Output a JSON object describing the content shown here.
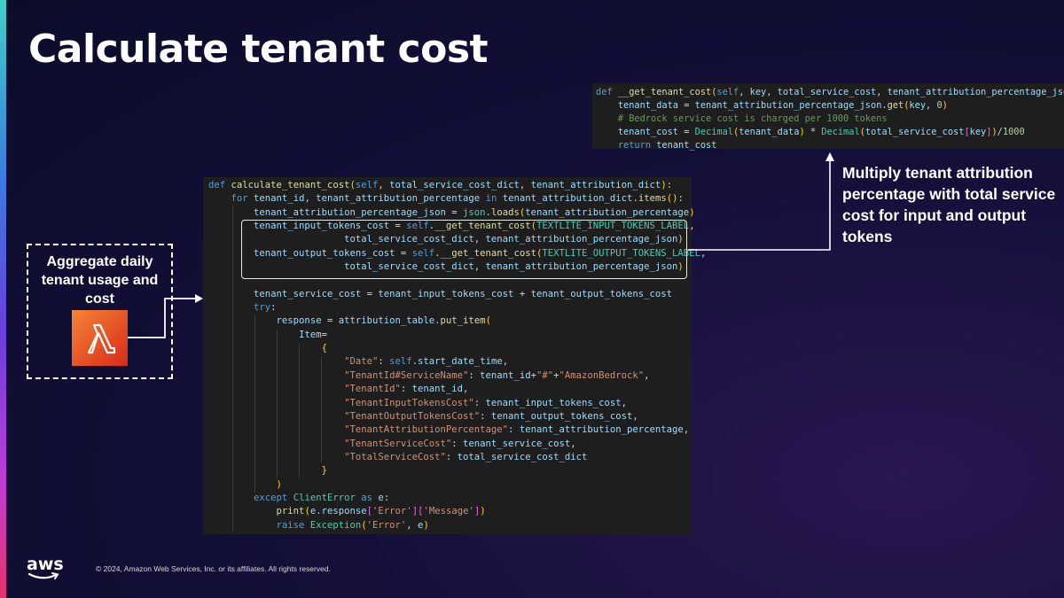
{
  "slide": {
    "title": "Calculate tenant cost",
    "aggregate_label": "Aggregate daily tenant usage and cost",
    "callout_text": "Multiply tenant attribution percentage with total service cost for input and output tokens",
    "footer": "© 2024, Amazon Web Services, Inc. or its affiliates. All rights reserved.",
    "logo_text": "aws",
    "lambda_icon": "lambda-icon",
    "accent_colors": {
      "lambda_start": "#f58536",
      "lambda_end": "#d9291a"
    }
  },
  "code_small": [
    "def __get_tenant_cost(self, key, total_service_cost, tenant_attribution_percentage_json):",
    "    tenant_data = tenant_attribution_percentage_json.get(key, 0)",
    "    # Bedrock service cost is charged per 1000 tokens",
    "    tenant_cost = Decimal(tenant_data) * Decimal(total_service_cost[key])/1000",
    "    return tenant_cost"
  ],
  "code_main": [
    "def calculate_tenant_cost(self, total_service_cost_dict, tenant_attribution_dict):",
    "    for tenant_id, tenant_attribution_percentage in tenant_attribution_dict.items():",
    "        tenant_attribution_percentage_json = json.loads(tenant_attribution_percentage)",
    "        tenant_input_tokens_cost = self.__get_tenant_cost(TEXTLITE_INPUT_TOKENS_LABEL,",
    "                        total_service_cost_dict, tenant_attribution_percentage_json)",
    "        tenant_output_tokens_cost = self.__get_tenant_cost(TEXTLITE_OUTPUT_TOKENS_LABEL,",
    "                        total_service_cost_dict, tenant_attribution_percentage_json)",
    "",
    "        tenant_service_cost = tenant_input_tokens_cost + tenant_output_tokens_cost",
    "        try:",
    "            response = attribution_table.put_item(",
    "                Item=",
    "                    {",
    "                        \"Date\": self.start_date_time,",
    "                        \"TenantId#ServiceName\": tenant_id+\"#\"+\"AmazonBedrock\",",
    "                        \"TenantId\": tenant_id,",
    "                        \"TenantInputTokensCost\": tenant_input_tokens_cost,",
    "                        \"TenantOutputTokensCost\": tenant_output_tokens_cost,",
    "                        \"TenantAttributionPercentage\": tenant_attribution_percentage,",
    "                        \"TenantServiceCost\": tenant_service_cost,",
    "                        \"TotalServiceCost\": total_service_cost_dict",
    "                    }",
    "            )",
    "        except ClientError as e:",
    "            print(e.response['Error']['Message'])",
    "            raise Exception('Error', e)"
  ]
}
